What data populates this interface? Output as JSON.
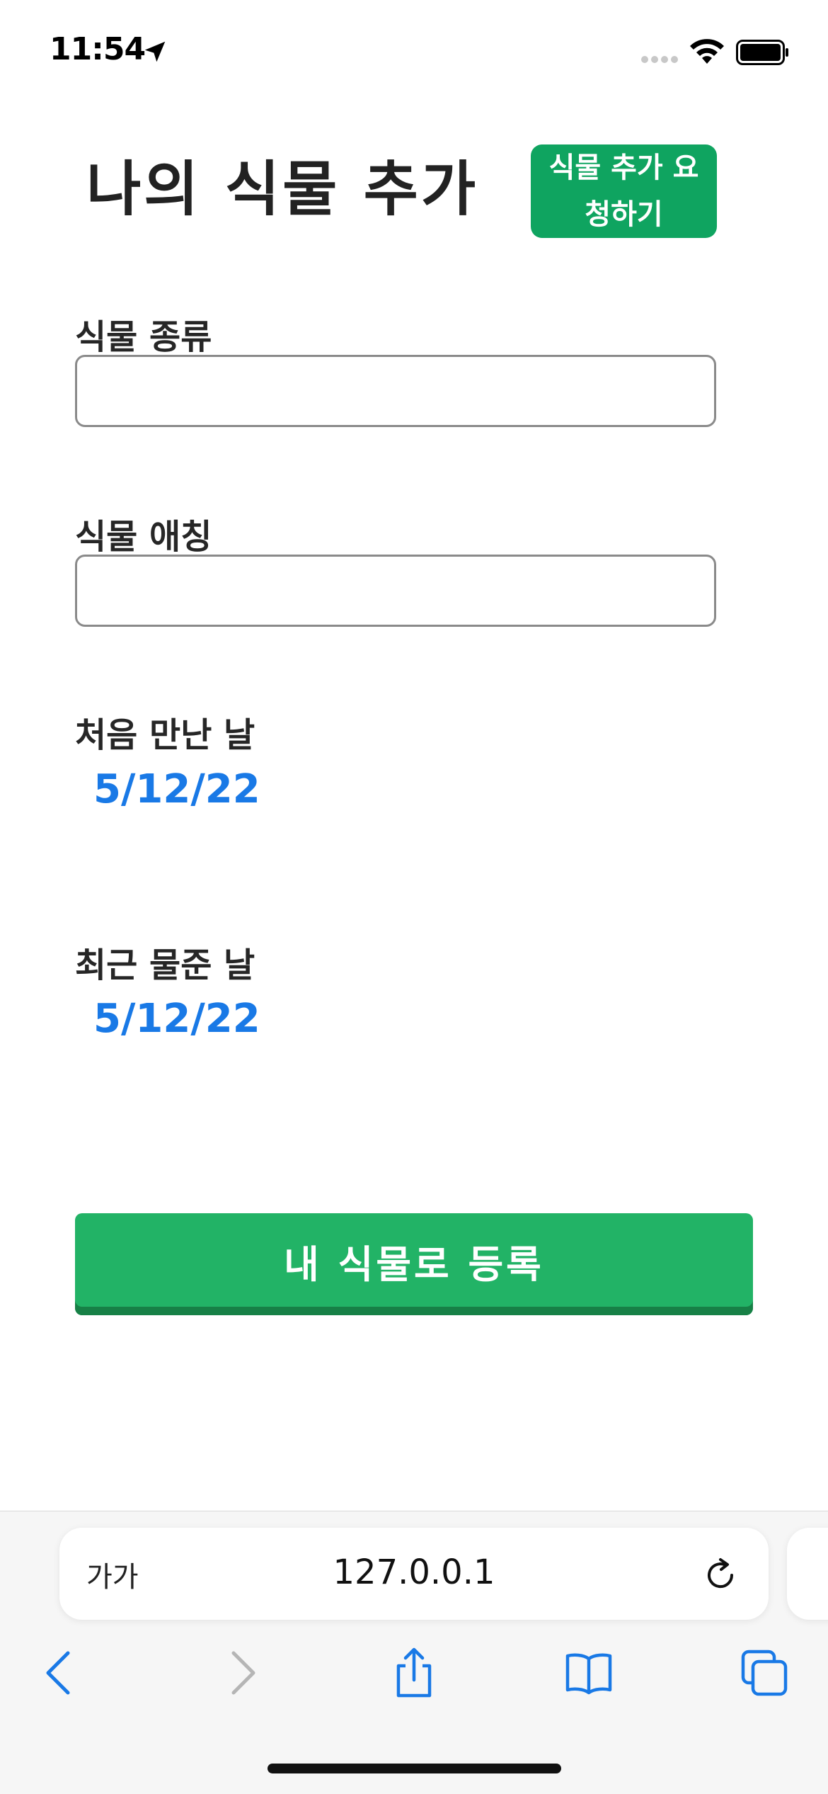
{
  "status_bar": {
    "time": "11:54"
  },
  "header": {
    "title": "나의 식물 추가",
    "request_button_label": "식물 추가 요청하기"
  },
  "form": {
    "plant_type_label": "식물 종류",
    "plant_type_value": "",
    "plant_nickname_label": "식물 애칭",
    "plant_nickname_value": "",
    "first_met_label": "처음 만난 날",
    "first_met_value": "5/12/22",
    "last_watered_label": "최근 물준 날",
    "last_watered_value": "5/12/22",
    "submit_label": "내 식물로 등록"
  },
  "browser": {
    "text_size_label": "가가",
    "url": "127.0.0.1"
  },
  "colors": {
    "request_button": "#0fa460",
    "submit_button": "#22b366",
    "date_value": "#1979e6",
    "toolbar_icon": "#1979e6"
  }
}
